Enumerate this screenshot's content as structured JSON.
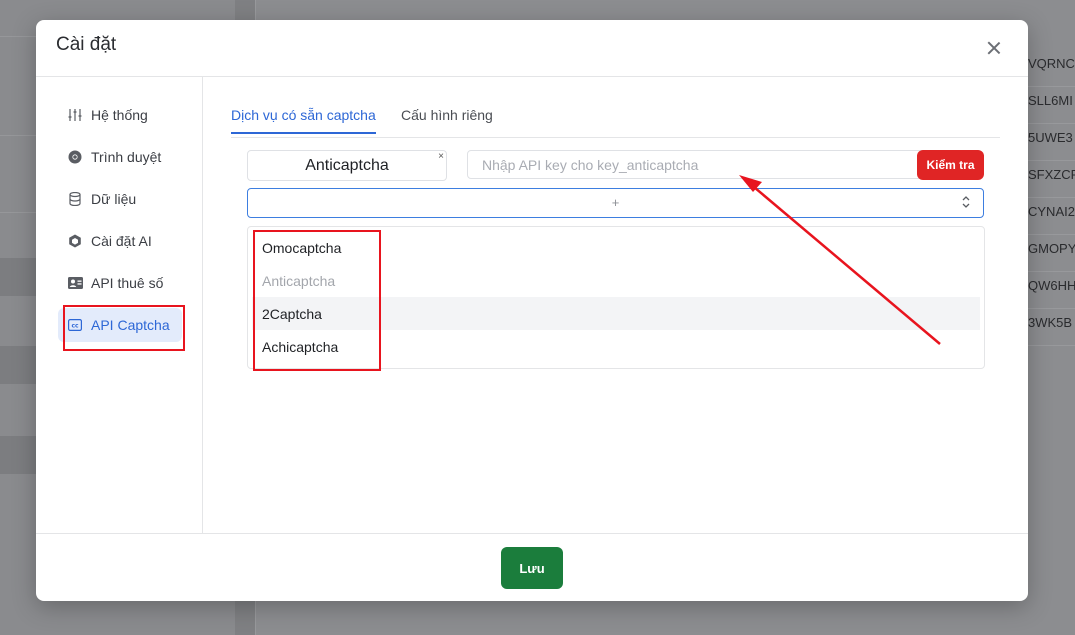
{
  "background": {
    "ids": [
      "VQRNC",
      "SLL6MI",
      "5UWE3",
      "SFXZCF",
      "CYNAI2",
      "GMOPY",
      "QW6HH",
      "3WK5B"
    ]
  },
  "modal": {
    "title": "Cài đặt",
    "sidebar": {
      "items": [
        {
          "label": "Hệ thống",
          "icon": "sliders-icon"
        },
        {
          "label": "Trình duyệt",
          "icon": "chrome-icon"
        },
        {
          "label": "Dữ liệu",
          "icon": "database-icon"
        },
        {
          "label": "Cài đặt AI",
          "icon": "ai-cube-icon"
        },
        {
          "label": "API thuê số",
          "icon": "contact-card-icon"
        },
        {
          "label": "API Captcha",
          "icon": "captcha-cc-icon",
          "active": true
        }
      ]
    },
    "tabs": [
      {
        "label": "Dịch vụ có sẵn captcha",
        "active": true
      },
      {
        "label": "Cấu hình riêng",
        "active": false
      }
    ],
    "chip": {
      "label": "Anticaptcha",
      "remove": "×"
    },
    "api_input": {
      "value": "",
      "placeholder": "Nhập API key cho key_anticaptcha"
    },
    "check_button": "Kiểm tra",
    "select": {
      "plus": "+"
    },
    "options": [
      {
        "label": "Omocaptcha",
        "disabled": false
      },
      {
        "label": "Anticaptcha",
        "disabled": true
      },
      {
        "label": "2Captcha",
        "disabled": false,
        "hovered": true
      },
      {
        "label": "Achicaptcha",
        "disabled": false
      }
    ],
    "save_button": "Lưu"
  },
  "colors": {
    "accent": "#2d67d6",
    "danger": "#e02525",
    "success": "#1b7d3c",
    "annotation": "#e8141e"
  }
}
